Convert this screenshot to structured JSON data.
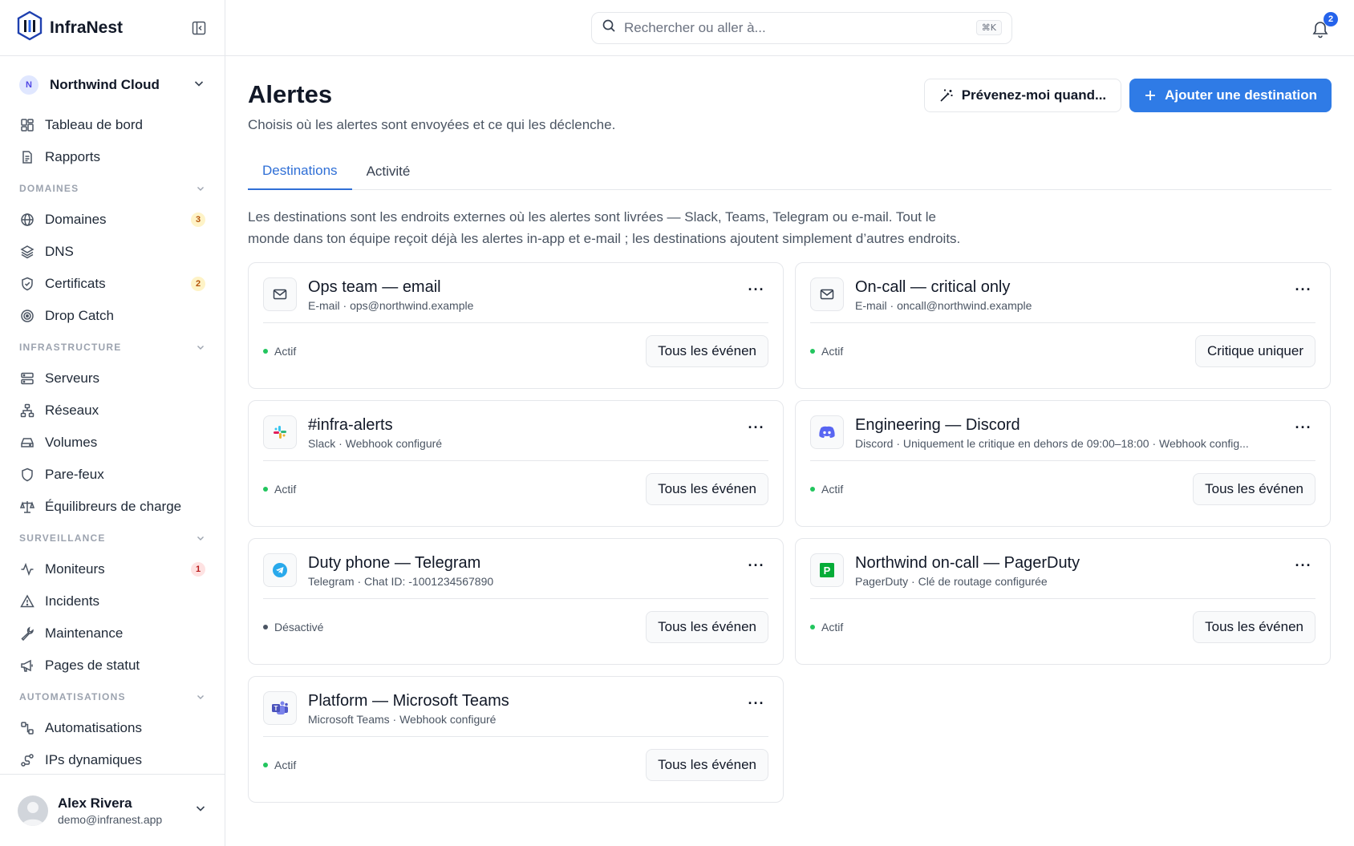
{
  "brand": {
    "name": "InfraNest"
  },
  "org": {
    "initial": "N",
    "name": "Northwind Cloud"
  },
  "nav": {
    "top": [
      {
        "label": "Tableau de bord",
        "icon": "dashboard-icon"
      },
      {
        "label": "Rapports",
        "icon": "report-icon"
      }
    ],
    "sections": [
      {
        "title": "DOMAINES",
        "items": [
          {
            "label": "Domaines",
            "icon": "globe-icon",
            "badge": "3",
            "badge_color": "amber"
          },
          {
            "label": "DNS",
            "icon": "layers-icon"
          },
          {
            "label": "Certificats",
            "icon": "shield-check-icon",
            "badge": "2",
            "badge_color": "amber"
          },
          {
            "label": "Drop Catch",
            "icon": "target-icon"
          }
        ]
      },
      {
        "title": "INFRASTRUCTURE",
        "items": [
          {
            "label": "Serveurs",
            "icon": "server-icon"
          },
          {
            "label": "Réseaux",
            "icon": "network-icon"
          },
          {
            "label": "Volumes",
            "icon": "drive-icon"
          },
          {
            "label": "Pare-feux",
            "icon": "shield-icon"
          },
          {
            "label": "Équilibreurs de charge",
            "icon": "scale-icon"
          }
        ]
      },
      {
        "title": "SURVEILLANCE",
        "items": [
          {
            "label": "Moniteurs",
            "icon": "activity-icon",
            "badge": "1",
            "badge_color": "red"
          },
          {
            "label": "Incidents",
            "icon": "warning-icon"
          },
          {
            "label": "Maintenance",
            "icon": "wrench-icon"
          },
          {
            "label": "Pages de statut",
            "icon": "megaphone-icon"
          }
        ]
      },
      {
        "title": "AUTOMATISATIONS",
        "items": [
          {
            "label": "Automatisations",
            "icon": "workflow-icon"
          },
          {
            "label": "IPs dynamiques",
            "icon": "dynamic-ip-icon"
          }
        ]
      }
    ]
  },
  "user": {
    "name": "Alex Rivera",
    "email": "demo@infranest.app"
  },
  "search": {
    "placeholder": "Rechercher ou aller à...",
    "shortcut": "⌘K"
  },
  "notifications": {
    "count": "2"
  },
  "page": {
    "title": "Alertes",
    "subtitle": "Choisis où les alertes sont envoyées et ce qui les déclenche.",
    "notify_button": "Prévenez-moi quand...",
    "add_button": "Ajouter une destination",
    "tabs": [
      "Destinations",
      "Activité"
    ],
    "description": "Les destinations sont les endroits externes où les alertes sont livrées — Slack, Teams, Telegram ou e-mail. Tout le monde dans ton équipe reçoit déjà les alertes in-app et e-mail ; les destinations ajoutent simplement d’autres endroits."
  },
  "destinations": [
    {
      "icon": "mail-icon",
      "title": "Ops team — email",
      "sub": "E-mail · ops@northwind.example",
      "status": "Actif",
      "status_color": "#22c55e",
      "filter": "Tous les événen"
    },
    {
      "icon": "mail-icon",
      "title": "On-call — critical only",
      "sub": "E-mail · oncall@northwind.example",
      "status": "Actif",
      "status_color": "#22c55e",
      "filter": "Critique uniquer"
    },
    {
      "icon": "slack-icon",
      "title": "#infra-alerts",
      "sub": "Slack · Webhook configuré",
      "status": "Actif",
      "status_color": "#22c55e",
      "filter": "Tous les événen"
    },
    {
      "icon": "discord-icon",
      "title": "Engineering — Discord",
      "sub": "Discord · Uniquement le critique en dehors de 09:00–18:00 · Webhook config...",
      "status": "Actif",
      "status_color": "#22c55e",
      "filter": "Tous les événen"
    },
    {
      "icon": "telegram-icon",
      "title": "Duty phone — Telegram",
      "sub": "Telegram · Chat ID: -1001234567890",
      "status": "Désactivé",
      "status_color": "#4b5563",
      "filter": "Tous les événen"
    },
    {
      "icon": "pagerduty-icon",
      "title": "Northwind on-call — PagerDuty",
      "sub": "PagerDuty · Clé de routage configurée",
      "status": "Actif",
      "status_color": "#22c55e",
      "filter": "Tous les événen"
    },
    {
      "icon": "teams-icon",
      "title": "Platform — Microsoft Teams",
      "sub": "Microsoft Teams · Webhook configuré",
      "status": "Actif",
      "status_color": "#22c55e",
      "filter": "Tous les événen"
    }
  ],
  "colors": {
    "accent": "#2f7be6",
    "tab_active": "#2f6fd6",
    "active_dot": "#22c55e"
  }
}
